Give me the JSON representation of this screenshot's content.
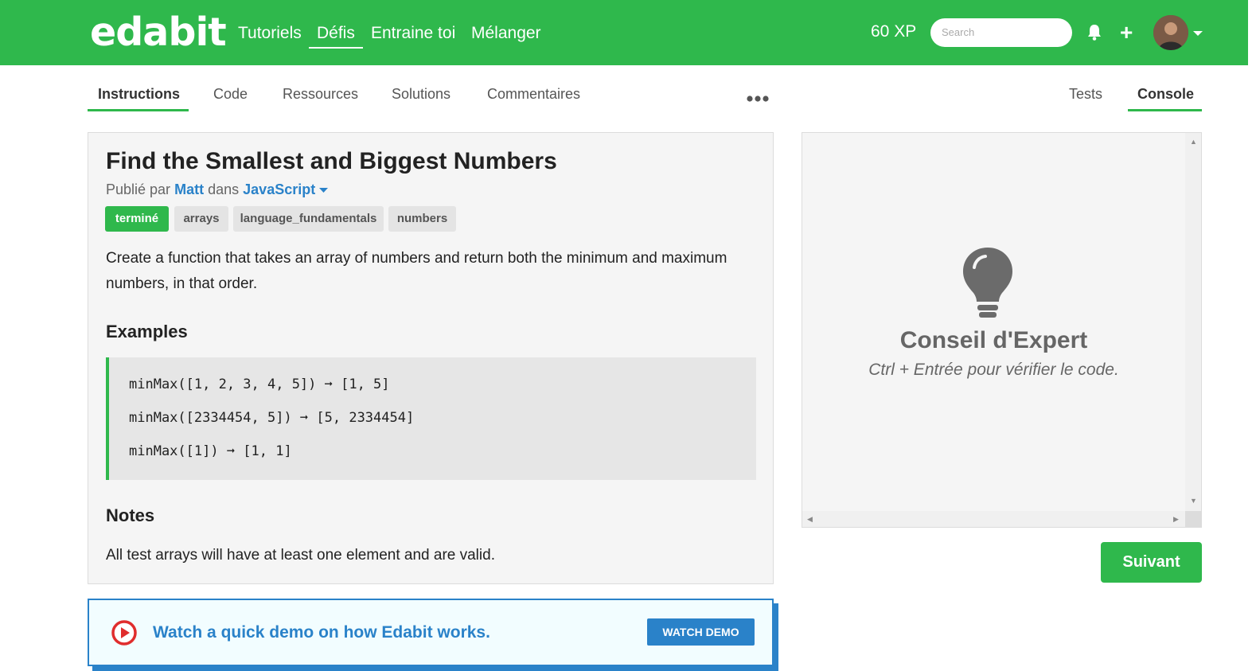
{
  "navbar": {
    "logo": "edabit",
    "links": [
      "Tutoriels",
      "Défis",
      "Entraine toi",
      "Mélanger"
    ],
    "active_link": "Défis",
    "xp": "60 XP",
    "search_placeholder": "Search",
    "bg_color": "#2fb84c"
  },
  "tabs": {
    "left": [
      "Instructions",
      "Code",
      "Ressources",
      "Solutions",
      "Commentaires"
    ],
    "right": [
      "Tests",
      "Console"
    ],
    "active_left": "Instructions",
    "active_right": "Console"
  },
  "challenge": {
    "title": "Find the Smallest and Biggest Numbers",
    "published_prefix": "Publié par",
    "author": "Matt",
    "in_word": "dans",
    "language": "JavaScript",
    "tags": [
      "terminé",
      "arrays",
      "language_fundamentals",
      "numbers"
    ],
    "description": "Create a function that takes an array of numbers and return both the minimum and maximum numbers, in that order.",
    "examples_heading": "Examples",
    "examples": [
      "minMax([1, 2, 3, 4, 5]) ➞ [1, 5]",
      "minMax([2334454, 5]) ➞ [5, 2334454]",
      "minMax([1]) ➞ [1, 1]"
    ],
    "notes_heading": "Notes",
    "notes": "All test arrays will have at least one element and are valid."
  },
  "demo": {
    "text": "Watch a quick demo on how Edabit works.",
    "button": "WATCH DEMO"
  },
  "console": {
    "tip_title": "Conseil d'Expert",
    "tip_subtitle": "Ctrl + Entrée pour vérifier le code."
  },
  "next_button": "Suivant",
  "icons": [
    "bell-icon",
    "plus-icon",
    "caret-down-icon",
    "more-dots-icon",
    "play-icon",
    "lightbulb-icon"
  ],
  "colors": {
    "accent_green": "#2fb84c",
    "link_blue": "#2a82c9"
  }
}
